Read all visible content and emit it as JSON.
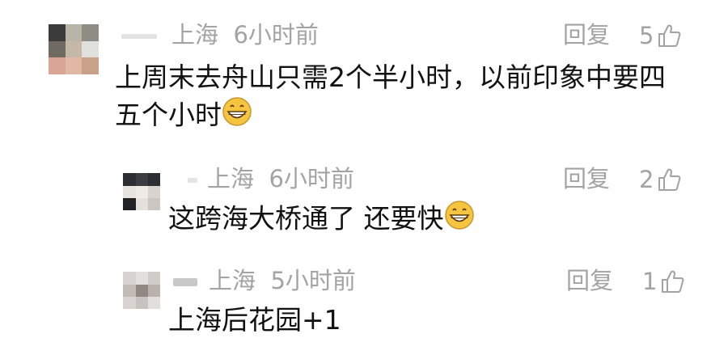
{
  "comments": [
    {
      "location": "上海",
      "time": "6小时前",
      "reply_label": "回复",
      "like_count": "5",
      "text_line1": "上周末去舟山只需2个半小时，以前印象中要四",
      "text_line2": "五个小时",
      "emoji": "grinning-face"
    },
    {
      "location": "上海",
      "time": "6小时前",
      "reply_label": "回复",
      "like_count": "2",
      "text_line1": "这跨海大桥通了 还要快",
      "emoji": "grinning-face"
    },
    {
      "location": "上海",
      "time": "5小时前",
      "reply_label": "回复",
      "like_count": "1",
      "text_line1": "上海后花园+1"
    }
  ],
  "colors": {
    "meta_text": "#a3a3a3",
    "body_text": "#111111",
    "emoji_face": "#f5c542"
  }
}
